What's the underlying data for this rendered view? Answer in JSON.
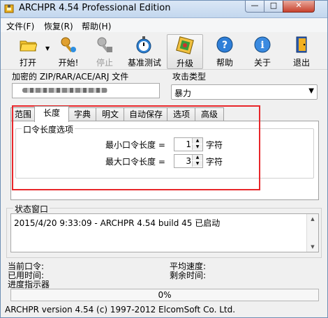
{
  "window": {
    "title": "ARCHPR 4.54 Professional Edition"
  },
  "menu": [
    "文件(F)",
    "恢复(R)",
    "帮助(H)"
  ],
  "toolbar": {
    "open": "打开",
    "start": "开始!",
    "stop": "停止",
    "benchmark": "基准测试",
    "upgrade": "升级",
    "help": "帮助",
    "about": "关于",
    "exit": "退出"
  },
  "form": {
    "encrypted_label": "加密的 ZIP/RAR/ACE/ARJ 文件",
    "attack_label": "攻击类型",
    "attack_value": "暴力"
  },
  "tabs": [
    "范围",
    "长度",
    "字典",
    "明文",
    "自动保存",
    "选项",
    "高级"
  ],
  "active_tab": "长度",
  "length": {
    "group_title": "口令长度选项",
    "min_label": "最小口令长度 =",
    "min_value": "1",
    "max_label": "最大口令长度 =",
    "max_value": "3",
    "unit": "字符"
  },
  "status": {
    "title": "状态窗口",
    "log": "2015/4/20 9:33:09 - ARCHPR 4.54 build 45 已启动"
  },
  "stats": {
    "current_password": "当前口令:",
    "elapsed": "已用时间:",
    "progress_indicator": "进度指示器",
    "avg_speed": "平均速度:",
    "remaining": "剩余时间:"
  },
  "progress": {
    "value": "0%"
  },
  "footer": "ARCHPR version 4.54 (c) 1997-2012 ElcomSoft Co. Ltd.",
  "colors": {
    "highlight": "#e8262a",
    "titlebar": "#c3d7ee",
    "close": "#c8412d"
  }
}
